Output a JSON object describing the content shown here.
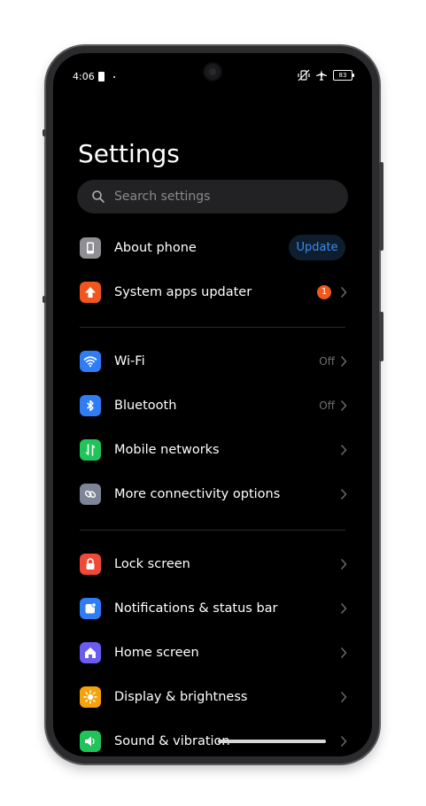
{
  "status_bar": {
    "time": "4:06",
    "battery": "83"
  },
  "page": {
    "title": "Settings"
  },
  "search": {
    "placeholder": "Search settings"
  },
  "group1": [
    {
      "label": "About phone",
      "action": "Update",
      "icon": "phone-info-icon",
      "color": "#8e8e93"
    },
    {
      "label": "System apps updater",
      "badge": "1",
      "icon": "arrow-up-icon",
      "color": "#f0561d"
    }
  ],
  "group2": [
    {
      "label": "Wi-Fi",
      "value": "Off",
      "icon": "wifi-icon",
      "color": "#2f7cf6"
    },
    {
      "label": "Bluetooth",
      "value": "Off",
      "icon": "bluetooth-icon",
      "color": "#2f7cf6"
    },
    {
      "label": "Mobile networks",
      "icon": "mobile-data-icon",
      "color": "#21c45a"
    },
    {
      "label": "More connectivity options",
      "icon": "link-icon",
      "color": "#7d8596"
    }
  ],
  "group3": [
    {
      "label": "Lock screen",
      "icon": "lock-icon",
      "color": "#ef4a36"
    },
    {
      "label": "Notifications & status bar",
      "icon": "notification-icon",
      "color": "#2f7cf6"
    },
    {
      "label": "Home screen",
      "icon": "home-icon",
      "color": "#6a5cf0"
    },
    {
      "label": "Display & brightness",
      "icon": "sun-icon",
      "color": "#f5a30c"
    },
    {
      "label": "Sound & vibration",
      "icon": "speaker-icon",
      "color": "#21c45a"
    }
  ]
}
